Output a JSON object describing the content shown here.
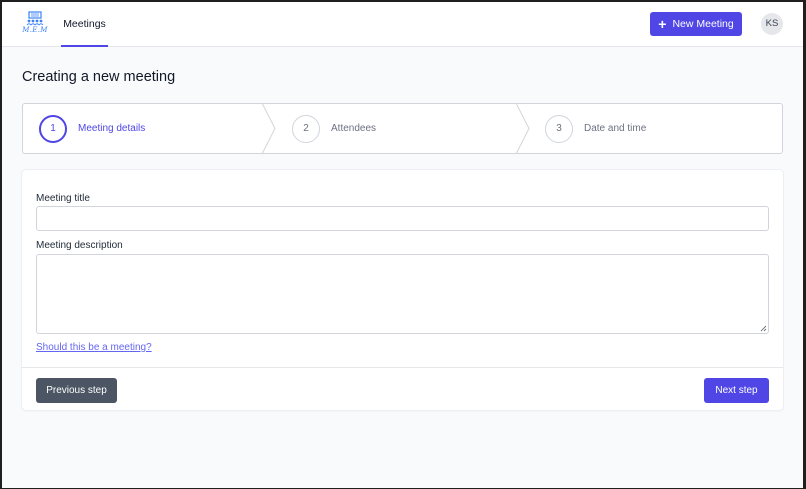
{
  "header": {
    "logo_text": "M.E.M",
    "nav_tab": "Meetings",
    "new_button": "New Meeting",
    "avatar_initials": "KS"
  },
  "page": {
    "title": "Creating a new meeting"
  },
  "steps": [
    {
      "number": "1",
      "label": "Meeting details",
      "state": "current"
    },
    {
      "number": "2",
      "label": "Attendees",
      "state": "upcoming"
    },
    {
      "number": "3",
      "label": "Date and time",
      "state": "upcoming"
    }
  ],
  "form": {
    "title_label": "Meeting title",
    "title_value": "",
    "description_label": "Meeting description",
    "description_value": "",
    "help_link": "Should this be a meeting?",
    "previous_button": "Previous step",
    "next_button": "Next step"
  },
  "colors": {
    "accent": "#4f46e5",
    "secondary_button": "#4b5563",
    "link": "#6366f1"
  }
}
